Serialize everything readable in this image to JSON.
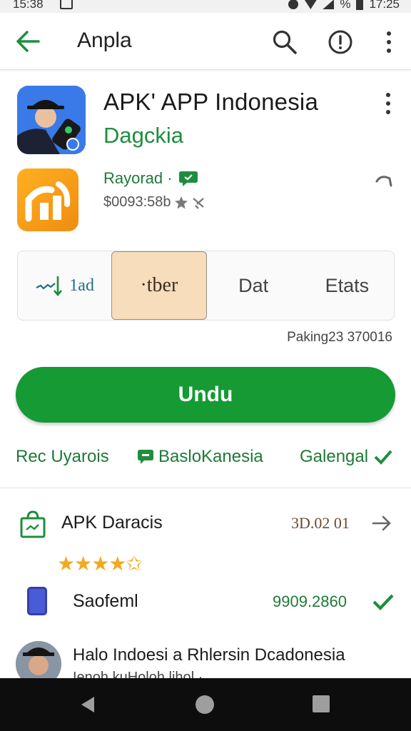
{
  "status_bar": {
    "time": "15:38",
    "right_time": "17:25",
    "percent": "%"
  },
  "app_bar": {
    "title": "Anpla",
    "back_icon": "arrow-left-icon",
    "search_icon": "search-icon",
    "info_icon": "info-icon",
    "menu_icon": "more-vert-icon"
  },
  "app": {
    "name": "APK' APP Indonesia",
    "developer": "Dagckia",
    "publisher": "Rayorad ·",
    "meta": "$0093:58b"
  },
  "tabs": [
    {
      "label": "1ad",
      "active": false
    },
    {
      "label": "·tber",
      "active": true
    },
    {
      "label": "Dat",
      "active": false
    },
    {
      "label": "Etats",
      "active": false
    }
  ],
  "package_text": "Paking23 370016",
  "install_label": "Undu",
  "chips": {
    "a": "Rec Uyarois",
    "b": "BasloKanesia",
    "c": "Galengal"
  },
  "rows": {
    "row1": {
      "label": "APK Daracis",
      "value": "3D.02 01"
    },
    "stars": "★★★★✩",
    "row2": {
      "label": "Saofeml",
      "value": "9909.2860"
    },
    "row3": {
      "label": "Halo Indoesi a Rhlersin Dcadonesia",
      "sub": "Ienoh kuHoloh lihol ·"
    }
  },
  "colors": {
    "accent_green": "#159a34",
    "text_green": "#1e8e3e",
    "active_tab": "#f7ddbc",
    "star": "#f2a91d",
    "nav_bar": "#0d0d0d"
  }
}
